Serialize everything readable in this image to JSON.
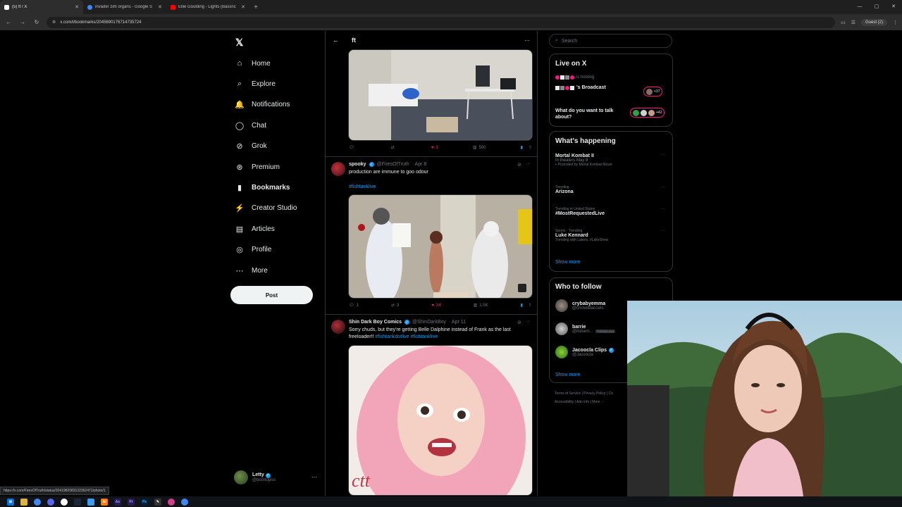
{
  "browser": {
    "tabs": [
      {
        "title": "(5) ft / X",
        "icon": "x-icon",
        "color": "#ffffff"
      },
      {
        "title": "invader zim organs - Google S",
        "icon": "google-icon",
        "color": "#4285f4"
      },
      {
        "title": "Ellie Goulding - Lights (Bassnc",
        "icon": "youtube-icon",
        "color": "#ff0000"
      }
    ],
    "url": "x.com/i/bookmarks/2045690176714735724",
    "profile": "Guest (2)",
    "status_url": "https://x.com/FiresOfTruth/status/2041982083132362471/photo/1"
  },
  "nav": {
    "items": [
      {
        "label": "Home",
        "icon": "home-icon",
        "glyph": "⌂"
      },
      {
        "label": "Explore",
        "icon": "search-icon",
        "glyph": "⌕"
      },
      {
        "label": "Notifications",
        "icon": "bell-icon",
        "glyph": "🔔"
      },
      {
        "label": "Chat",
        "icon": "chat-icon",
        "glyph": "◯"
      },
      {
        "label": "Grok",
        "icon": "grok-icon",
        "glyph": "⊘"
      },
      {
        "label": "Premium",
        "icon": "premium-icon",
        "glyph": "⊛"
      },
      {
        "label": "Bookmarks",
        "icon": "bookmark-icon",
        "glyph": "▮"
      },
      {
        "label": "Creator Studio",
        "icon": "creator-icon",
        "glyph": "⚡"
      },
      {
        "label": "Articles",
        "icon": "articles-icon",
        "glyph": "▤"
      },
      {
        "label": "Profile",
        "icon": "profile-icon",
        "glyph": "◎"
      },
      {
        "label": "More",
        "icon": "more-icon",
        "glyph": "⋯"
      }
    ],
    "post_label": "Post",
    "user": {
      "name": "Letty",
      "handle": "@bomtopiss"
    }
  },
  "main": {
    "title": "ft",
    "tweet0": {
      "replies": "",
      "reposts": "",
      "likes": "3",
      "views": "500"
    },
    "tweet1": {
      "name": "spooky",
      "handle": "@FiresOfTruth",
      "date": "· Apr 8",
      "text": "production are immune to goo odour",
      "hashtag": "#fishtanklive",
      "replies": "1",
      "reposts": "3",
      "likes": "34",
      "views": "1.5K"
    },
    "tweet2": {
      "name": "Shin Dark Boy Comics",
      "handle": "@ShinDarkBoy",
      "date": "· Apr 11",
      "text": "Sorry chuds, but they're getting Belle Dalphine instead of Frank as the last freeloader!!",
      "hashtags": "#fishtankdotlive #fishtanklive"
    }
  },
  "right": {
    "search_placeholder": "Search",
    "live": {
      "title": "Live on X",
      "hosting": "is hosting",
      "broadcast": "'s Broadcast",
      "count1": "+37",
      "question": "What do you want to talk about?",
      "count2": "+42"
    },
    "happening": {
      "title": "What's happening",
      "items": [
        {
          "context": "",
          "title": "Mortal Kombat II",
          "sub": "In theaters May 8",
          "promo": "Promoted by Mortal Kombat Movie"
        },
        {
          "context": "Trending",
          "title": "Arizona",
          "sub": "",
          "promo": ""
        },
        {
          "context": "Trending in United States",
          "title": "#MostRequestedLive",
          "sub": "",
          "promo": ""
        },
        {
          "context": "Sports · Trending",
          "title": "Luke Kennard",
          "sub": "Trending with Lakers, #LakeShow",
          "promo": ""
        }
      ],
      "show_more": "Show more"
    },
    "follow": {
      "title": "Who to follow",
      "items": [
        {
          "name": "crybabyemma",
          "handle": "@cricketdan1els",
          "tag": ""
        },
        {
          "name": "barrie",
          "handle": "@itsbarri...",
          "tag": "Follows you"
        },
        {
          "name": "Jacoocla Clips",
          "handle": "@Jacoocla",
          "tag": ""
        }
      ],
      "show_more": "Show more"
    },
    "footer": {
      "line1": "Terms of Service  |  Privacy Policy  |  Co",
      "line2": "Accessibility  |  Ads info  |  More ···"
    }
  },
  "colors": {
    "accent": "#1d9bf0",
    "like": "#f91880",
    "bg": "#000000",
    "border": "#2f3336"
  }
}
